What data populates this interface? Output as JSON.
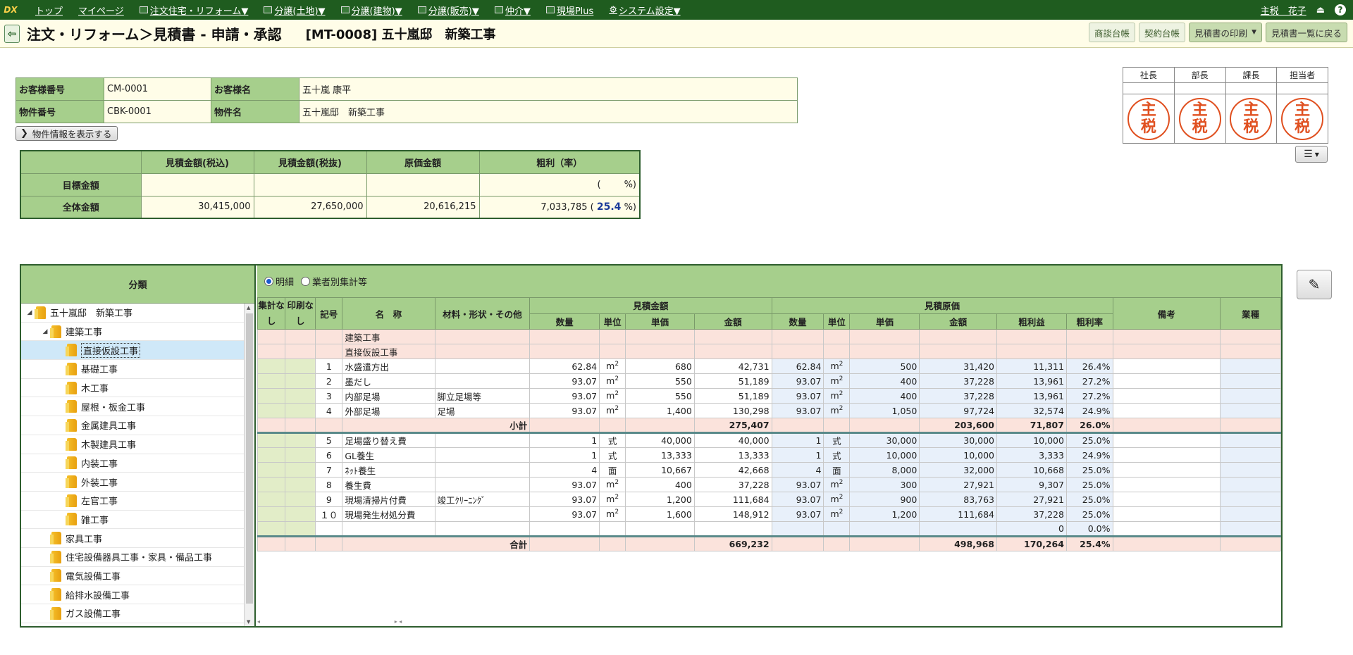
{
  "nav": {
    "logo": "DX",
    "items": [
      "トップ",
      "マイページ",
      "注文住宅・リフォーム▼",
      "分譲(土地)▼",
      "分譲(建物)▼",
      "分譲(販売)▼",
      "仲介▼",
      "現場Plus",
      "システム設定▼"
    ],
    "user": "主税　花子",
    "logout_icon": "⏏",
    "help": "?"
  },
  "title": {
    "back": "⇦",
    "heading": "注文・リフォーム＞見積書 - 申請・承認",
    "project": "[MT-0008] 五十嵐邸　新築工事",
    "buttons": [
      "商談台帳",
      "契約台帳",
      "見積書の印刷",
      "見積書一覧に戻る"
    ]
  },
  "customer": {
    "labels": [
      "お客様番号",
      "お客様名",
      "物件番号",
      "物件名"
    ],
    "values": [
      "CM-0001",
      "五十嵐 康平",
      "CBK-0001",
      "五十嵐邸　新築工事"
    ]
  },
  "show_property_button": "物件情報を表示する",
  "stamps": {
    "roles": [
      "社長",
      "部長",
      "課長",
      "担当者"
    ],
    "text": [
      "主",
      "税"
    ]
  },
  "summary": {
    "headers": [
      "見積金額(税込)",
      "見積金額(税抜)",
      "原価金額",
      "粗利（率）"
    ],
    "target": {
      "label": "目標金額",
      "profit": "(        %)"
    },
    "total": {
      "label": "全体金額",
      "taxin": "30,415,000",
      "taxout": "27,650,000",
      "cost": "20,616,215",
      "profit": "7,033,785 (",
      "rate": "25.4",
      "suffix": "%)"
    }
  },
  "tree": {
    "header": "分類",
    "nodes": [
      {
        "label": "五十嵐邸　新築工事",
        "level": 0,
        "toggle": "◢"
      },
      {
        "label": "建築工事",
        "level": 1,
        "toggle": "◢"
      },
      {
        "label": "直接仮設工事",
        "level": 2,
        "toggle": "",
        "selected": true
      },
      {
        "label": "基礎工事",
        "level": 2,
        "toggle": ""
      },
      {
        "label": "木工事",
        "level": 2,
        "toggle": ""
      },
      {
        "label": "屋根・板金工事",
        "level": 2,
        "toggle": ""
      },
      {
        "label": "金属建具工事",
        "level": 2,
        "toggle": ""
      },
      {
        "label": "木製建具工事",
        "level": 2,
        "toggle": ""
      },
      {
        "label": "内装工事",
        "level": 2,
        "toggle": ""
      },
      {
        "label": "外装工事",
        "level": 2,
        "toggle": ""
      },
      {
        "label": "左官工事",
        "level": 2,
        "toggle": ""
      },
      {
        "label": "雑工事",
        "level": 2,
        "toggle": ""
      },
      {
        "label": "家具工事",
        "level": 1,
        "toggle": ""
      },
      {
        "label": "住宅設備器具工事・家具・備品工事",
        "level": 1,
        "toggle": ""
      },
      {
        "label": "電気設備工事",
        "level": 1,
        "toggle": ""
      },
      {
        "label": "給排水設備工事",
        "level": 1,
        "toggle": ""
      },
      {
        "label": "ガス設備工事",
        "level": 1,
        "toggle": ""
      }
    ]
  },
  "detail": {
    "radio": [
      "明細",
      "業者別集計等"
    ],
    "groups": [
      "見積金額",
      "見積原価"
    ],
    "headers": [
      "集計なし",
      "印刷なし",
      "記号",
      "名　称",
      "材料・形状・その他",
      "数量",
      "単位",
      "単価",
      "金額",
      "数量",
      "単位",
      "単価",
      "金額",
      "粗利益",
      "粗利率",
      "備考",
      "業種"
    ],
    "rows": [
      {
        "type": "pk",
        "name": "建築工事"
      },
      {
        "type": "pk",
        "name": "直接仮設工事"
      },
      {
        "type": "item",
        "no": "1",
        "name": "水盛遣方出",
        "mat": "",
        "qty": "62.84",
        "unit": "m",
        "sup": "2",
        "price": "680",
        "amt": "42,731",
        "cqty": "62.84",
        "cunit": "m",
        "csup": "2",
        "cprice": "500",
        "camt": "31,420",
        "profit": "11,311",
        "rate": "26.4%"
      },
      {
        "type": "item",
        "no": "2",
        "name": "墨だし",
        "mat": "",
        "qty": "93.07",
        "unit": "m",
        "sup": "2",
        "price": "550",
        "amt": "51,189",
        "cqty": "93.07",
        "cunit": "m",
        "csup": "2",
        "cprice": "400",
        "camt": "37,228",
        "profit": "13,961",
        "rate": "27.2%"
      },
      {
        "type": "item",
        "no": "3",
        "name": "内部足場",
        "mat": "脚立足場等",
        "qty": "93.07",
        "unit": "m",
        "sup": "2",
        "price": "550",
        "amt": "51,189",
        "cqty": "93.07",
        "cunit": "m",
        "csup": "2",
        "cprice": "400",
        "camt": "37,228",
        "profit": "13,961",
        "rate": "27.2%"
      },
      {
        "type": "item",
        "no": "4",
        "name": "外部足場",
        "mat": "足場",
        "qty": "93.07",
        "unit": "m",
        "sup": "2",
        "price": "1,400",
        "amt": "130,298",
        "cqty": "93.07",
        "cunit": "m",
        "csup": "2",
        "cprice": "1,050",
        "camt": "97,724",
        "profit": "32,574",
        "rate": "24.9%"
      },
      {
        "type": "sub",
        "label": "小計",
        "amt": "275,407",
        "camt": "203,600",
        "profit": "71,807",
        "rate": "26.0%"
      },
      {
        "type": "item",
        "no": "5",
        "name": "足場盛り替え費",
        "mat": "",
        "qty": "1",
        "unit": "式",
        "sup": "",
        "price": "40,000",
        "amt": "40,000",
        "cqty": "1",
        "cunit": "式",
        "csup": "",
        "cprice": "30,000",
        "camt": "30,000",
        "profit": "10,000",
        "rate": "25.0%",
        "gap": true
      },
      {
        "type": "item",
        "no": "6",
        "name": "GL養生",
        "mat": "",
        "qty": "1",
        "unit": "式",
        "sup": "",
        "price": "13,333",
        "amt": "13,333",
        "cqty": "1",
        "cunit": "式",
        "csup": "",
        "cprice": "10,000",
        "camt": "10,000",
        "profit": "3,333",
        "rate": "24.9%"
      },
      {
        "type": "item",
        "no": "7",
        "name": "ﾈｯﾄ養生",
        "mat": "",
        "qty": "4",
        "unit": "面",
        "sup": "",
        "price": "10,667",
        "amt": "42,668",
        "cqty": "4",
        "cunit": "面",
        "csup": "",
        "cprice": "8,000",
        "camt": "32,000",
        "profit": "10,668",
        "rate": "25.0%"
      },
      {
        "type": "item",
        "no": "8",
        "name": "養生費",
        "mat": "",
        "qty": "93.07",
        "unit": "m",
        "sup": "2",
        "price": "400",
        "amt": "37,228",
        "cqty": "93.07",
        "cunit": "m",
        "csup": "2",
        "cprice": "300",
        "camt": "27,921",
        "profit": "9,307",
        "rate": "25.0%"
      },
      {
        "type": "item",
        "no": "9",
        "name": "現場清掃片付費",
        "mat": "竣工ｸﾘｰﾆﾝｸﾞ",
        "qty": "93.07",
        "unit": "m",
        "sup": "2",
        "price": "1,200",
        "amt": "111,684",
        "cqty": "93.07",
        "cunit": "m",
        "csup": "2",
        "cprice": "900",
        "camt": "83,763",
        "profit": "27,921",
        "rate": "25.0%"
      },
      {
        "type": "item",
        "no": "１０",
        "name": "現場発生材処分費",
        "mat": "",
        "qty": "93.07",
        "unit": "m",
        "sup": "2",
        "price": "1,600",
        "amt": "148,912",
        "cqty": "93.07",
        "cunit": "m",
        "csup": "2",
        "cprice": "1,200",
        "camt": "111,684",
        "profit": "37,228",
        "rate": "25.0%"
      },
      {
        "type": "item",
        "no": "",
        "name": "",
        "mat": "",
        "qty": "",
        "unit": "",
        "sup": "",
        "price": "",
        "amt": "",
        "cqty": "",
        "cunit": "",
        "csup": "",
        "cprice": "",
        "camt": "",
        "profit": "0",
        "rate": "0.0%"
      },
      {
        "type": "total",
        "label": "合計",
        "amt": "669,232",
        "camt": "498,968",
        "profit": "170,264",
        "rate": "25.4%"
      }
    ]
  },
  "edit_icon": "✎",
  "colors": {
    "nav": "#1f5c1f",
    "header_green": "#a6cf8c",
    "cream": "#fffde8",
    "stamp": "#e05020",
    "rate": "#1a3a9a"
  }
}
